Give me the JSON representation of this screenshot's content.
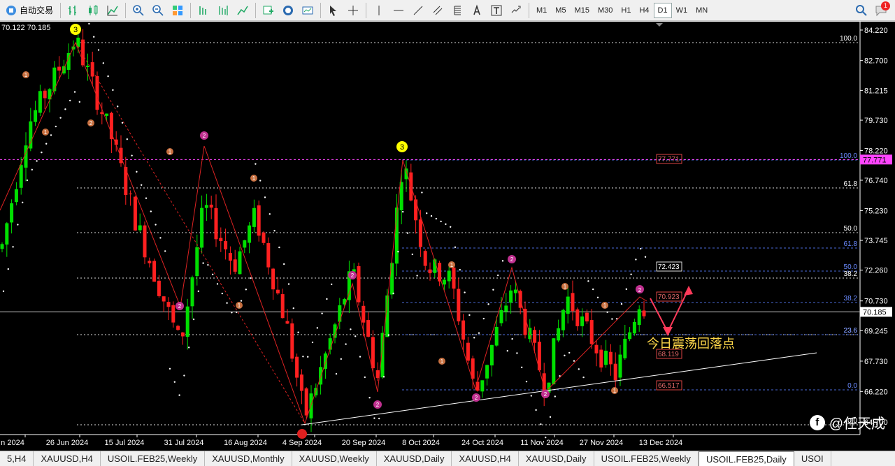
{
  "toolbar": {
    "auto_trade_label": "自动交易",
    "timeframes": [
      "M1",
      "M5",
      "M15",
      "M30",
      "H1",
      "H4",
      "D1",
      "W1",
      "MN"
    ],
    "active_timeframe": "D1",
    "notification_count": "1"
  },
  "chart_header": {
    "bid_ask": "70.122 70.185"
  },
  "chart_data": {
    "type": "candlestick",
    "price_axis": [
      "84.220",
      "82.700",
      "81.215",
      "79.730",
      "78.220",
      "76.740",
      "75.230",
      "73.745",
      "72.260",
      "70.730",
      "69.245",
      "67.730",
      "66.220",
      "64.700"
    ],
    "date_axis": [
      "n 2024",
      "26 Jun 2024",
      "15 Jul 2024",
      "31 Jul 2024",
      "16 Aug 2024",
      "4 Sep 2024",
      "20 Sep 2024",
      "8 Oct 2024",
      "24 Oct 2024",
      "11 Nov 2024",
      "27 Nov 2024",
      "13 Dec 2024"
    ],
    "current_price": "70.185",
    "purple_level": "77.771",
    "level_labels": [
      "77.771",
      "72.423",
      "70.923",
      "68.119",
      "66.517"
    ],
    "fib_left": [
      "100.0",
      "61.8",
      "50.0",
      "38.2",
      "23.6",
      "0.0"
    ],
    "fib_right": [
      "100.0",
      "61.8",
      "50.0",
      "38.2",
      "23.6",
      "0.0"
    ],
    "wave_labels": [
      "3",
      "1",
      "1",
      "2",
      "1",
      "1",
      "1",
      "2",
      "3",
      "1",
      "2",
      "2",
      "1",
      "2",
      "2",
      "1",
      "1",
      "2",
      "2",
      "1"
    ],
    "annotation": "今日震荡回落点",
    "colors": {
      "up": "#00e000",
      "down": "#ff2020",
      "purple": "#ff44ff",
      "fib": "#ffffff",
      "trend": "#ffffff"
    }
  },
  "watermark": "@任天成",
  "symbol_tabs": [
    "5,H4",
    "XAUUSD,H4",
    "USOIL.FEB25,Weekly",
    "XAUUSD,Monthly",
    "XAUUSD,Weekly",
    "XAUUSD,Daily",
    "XAUUSD,H4",
    "XAUUSD,Daily",
    "USOIL.FEB25,Weekly",
    "USOIL.FEB25,Daily",
    "USOI"
  ],
  "active_symbol_tab": "USOIL.FEB25,Daily"
}
